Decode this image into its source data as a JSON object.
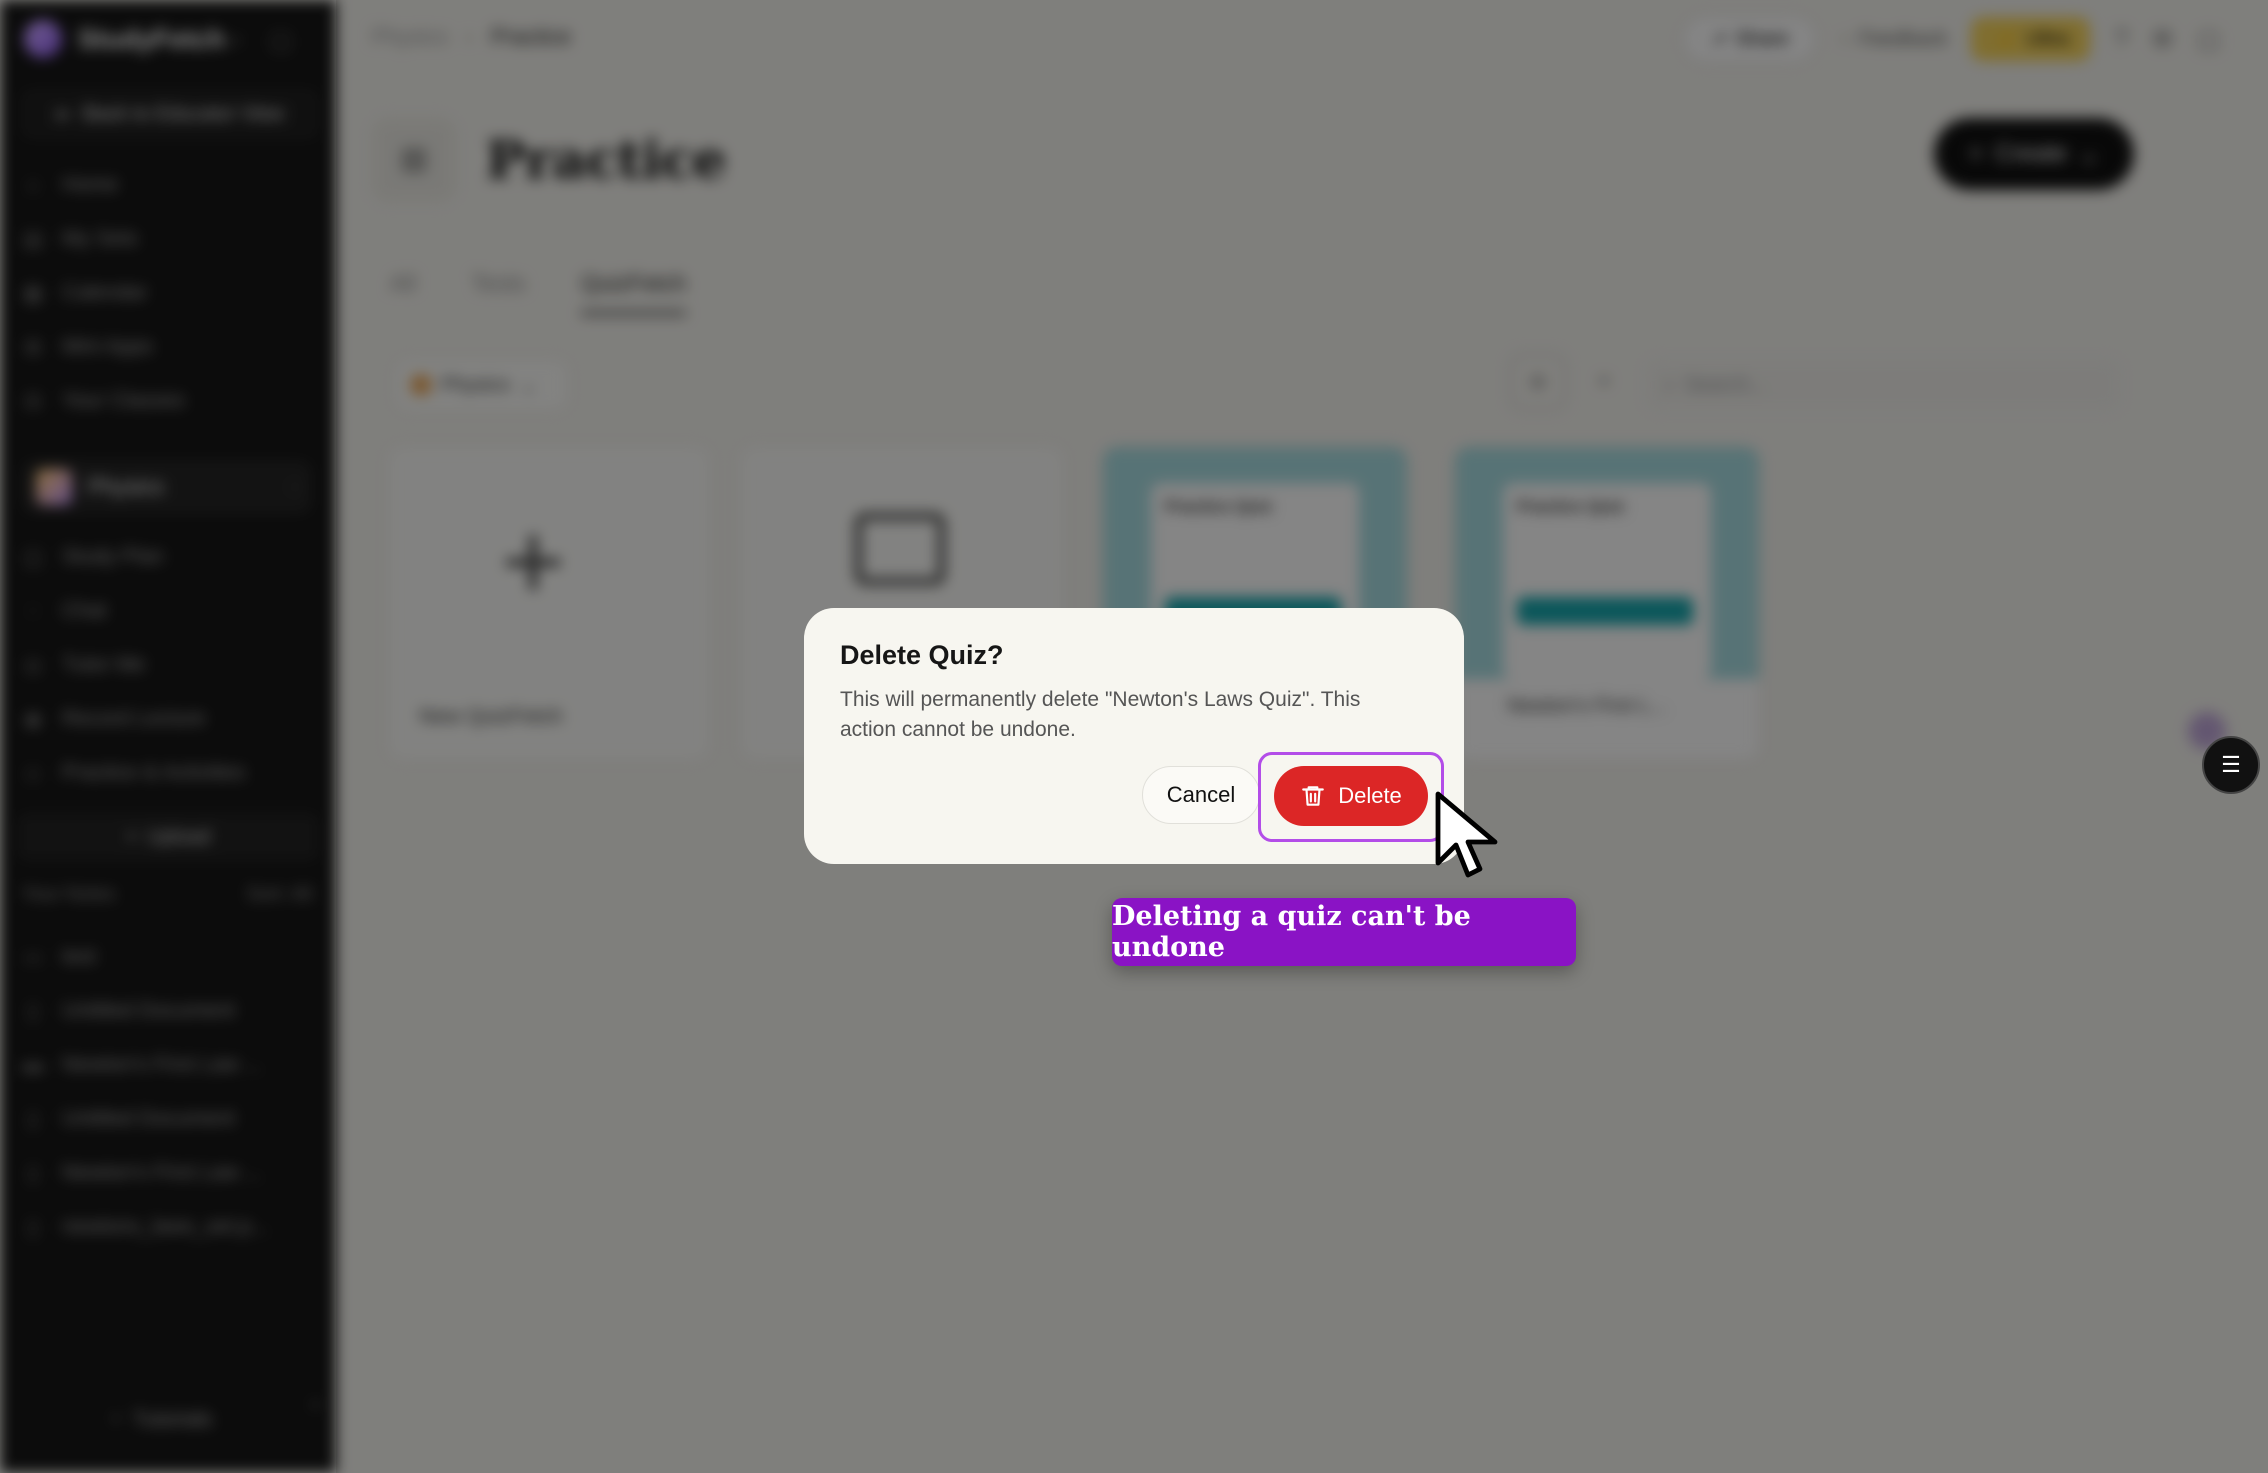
{
  "sidebar": {
    "brand_name": "StudyFetch",
    "back_label": "Back to Educator View",
    "nav_items": [
      {
        "label": "Home",
        "icon": "home-icon"
      },
      {
        "label": "My Sets",
        "icon": "stack-icon"
      },
      {
        "label": "Calendar",
        "icon": "calendar-icon"
      },
      {
        "label": "Mini Apps",
        "icon": "grid-icon"
      },
      {
        "label": "Your Classes",
        "icon": "classes-icon"
      }
    ],
    "course_name": "Physics",
    "course_items": [
      {
        "label": "Study Plan"
      },
      {
        "label": "Chat"
      },
      {
        "label": "Tutor Me"
      },
      {
        "label": "Record Lecture"
      },
      {
        "label": "Practice & Activities"
      }
    ],
    "upload_label": "Upload",
    "notes_header": "Your Notes",
    "notes_meta": "Sort: All",
    "notes_items": [
      {
        "label": "test"
      },
      {
        "label": "Untitled Document"
      },
      {
        "label": "Newton's First Law ..."
      },
      {
        "label": "Untitled Document"
      },
      {
        "label": "Newton's First Law ..."
      },
      {
        "label": "newtons_laws_set.p..."
      }
    ],
    "tutorials_label": "Tutorials"
  },
  "header": {
    "breadcrumb_parent": "Physics",
    "breadcrumb_current": "Practice",
    "share_label": "Share",
    "feedback_label": "Feedback",
    "plan_label": "Ultra"
  },
  "page": {
    "title": "Practice",
    "create_label": "Create",
    "tabs": [
      "All",
      "Tests",
      "QuizFetch"
    ],
    "subject_filter": "Physics",
    "search_placeholder": "Search...",
    "cards": {
      "new_label": "New QuizFetch",
      "quiz1_title": "Practice Quiz",
      "quiz2_title": "Practice Quiz",
      "quiz2_name": "Newton's First L..."
    }
  },
  "dialog": {
    "title": "Delete Quiz?",
    "message": "This will permanently delete \"Newton's Laws Quiz\". This action cannot be undone.",
    "cancel_label": "Cancel",
    "delete_label": "Delete"
  },
  "tooltip": {
    "text": "Deleting a quiz can't be undone"
  },
  "colors": {
    "delete": "#dc2626",
    "highlight": "#b34de8",
    "tooltip_bg": "#8a13c5"
  }
}
